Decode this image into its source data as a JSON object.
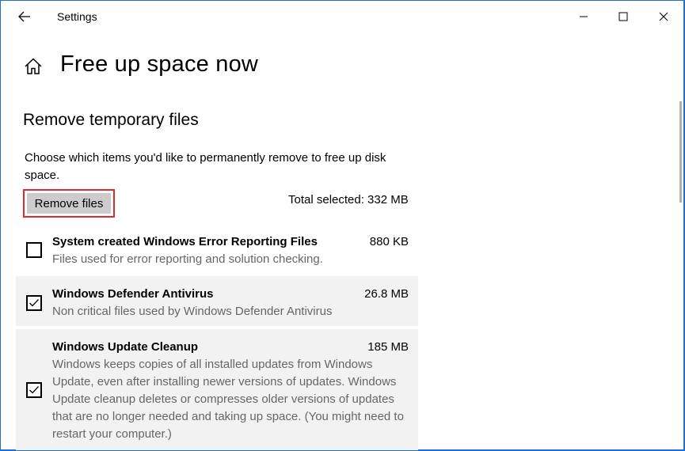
{
  "window": {
    "title": "Settings",
    "controls": [
      "minimize",
      "maximize",
      "close"
    ]
  },
  "header": {
    "icon": "home-icon",
    "title": "Free up space now"
  },
  "section": {
    "title": "Remove temporary files",
    "description": "Choose which items you'd like to permanently remove to free up disk space.",
    "remove_button_label": "Remove files",
    "total_selected": "Total selected: 332 MB"
  },
  "items": [
    {
      "name": "System created Windows Error Reporting Files",
      "size": "880 KB",
      "description": "Files used for error reporting and solution checking.",
      "checked": false
    },
    {
      "name": "Windows Defender Antivirus",
      "size": "26.8 MB",
      "description": "Non critical files used by Windows Defender Antivirus",
      "checked": true
    },
    {
      "name": "Windows Update Cleanup",
      "size": "185 MB",
      "description": "Windows keeps copies of all installed updates from Windows Update, even after installing newer versions of updates. Windows Update cleanup deletes or compresses older versions of updates that are no longer needed and taking up space. (You might need to restart your computer.)",
      "checked": true
    }
  ],
  "colors": {
    "highlight_border": "#e0292c",
    "button_bg": "#cccccc",
    "selected_row_bg": "#f2f2f2",
    "window_border": "#1f6fd1"
  }
}
